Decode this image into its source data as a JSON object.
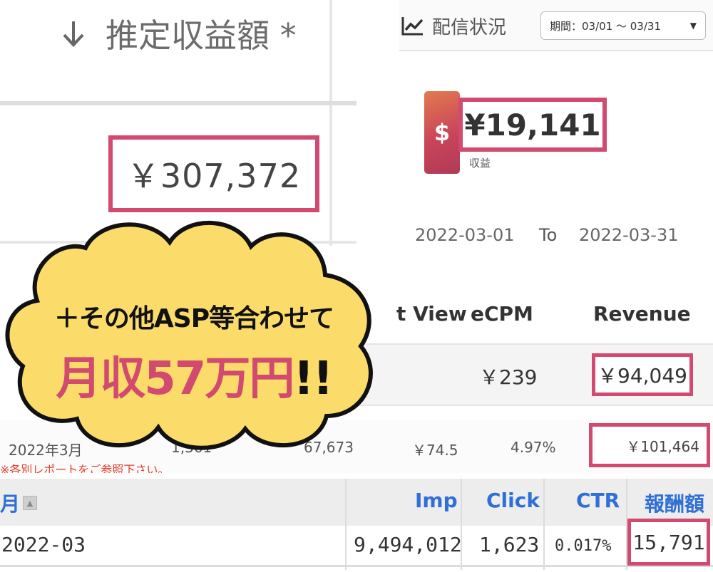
{
  "adsense": {
    "title": "推定収益額 *",
    "amount": "￥307,372"
  },
  "delivery": {
    "title": "配信状況",
    "period": "期間：03/01 〜 03/31",
    "currency_symbol": "$",
    "revenue": "¥19,141",
    "revenue_label": "収益",
    "date_from": "2022-03-01",
    "date_to_label": "To",
    "date_to": "2022-03-31"
  },
  "stats": {
    "headers": [
      "t View",
      "eCPM",
      "Revenue"
    ],
    "ecpm": "￥239",
    "revenue": "￥94,049"
  },
  "asp_row": {
    "month": "2022年3月",
    "value1": "1,361",
    "value2": "67,673",
    "value3": "￥74.5",
    "value4": "4.97%",
    "value5": "￥101,464",
    "note": "※各別レポートをご参照下さい。"
  },
  "affiliate": {
    "headers": {
      "month": "月",
      "imp": "Imp",
      "click": "Click",
      "ctr": "CTR",
      "reward": "報酬額"
    },
    "row": {
      "month": "2022-03",
      "imp": "9,494,012",
      "click": "1,623",
      "ctr": "0.017%",
      "reward": "15,791"
    }
  },
  "callout": {
    "line1": "＋その他ASP等合わせて",
    "line2": "月収57万円",
    "line2_suffix": "!!"
  },
  "colors": {
    "highlight": "#d24a6f",
    "cloud_fill": "#fbdc6a",
    "link_blue": "#2f6fd6"
  }
}
